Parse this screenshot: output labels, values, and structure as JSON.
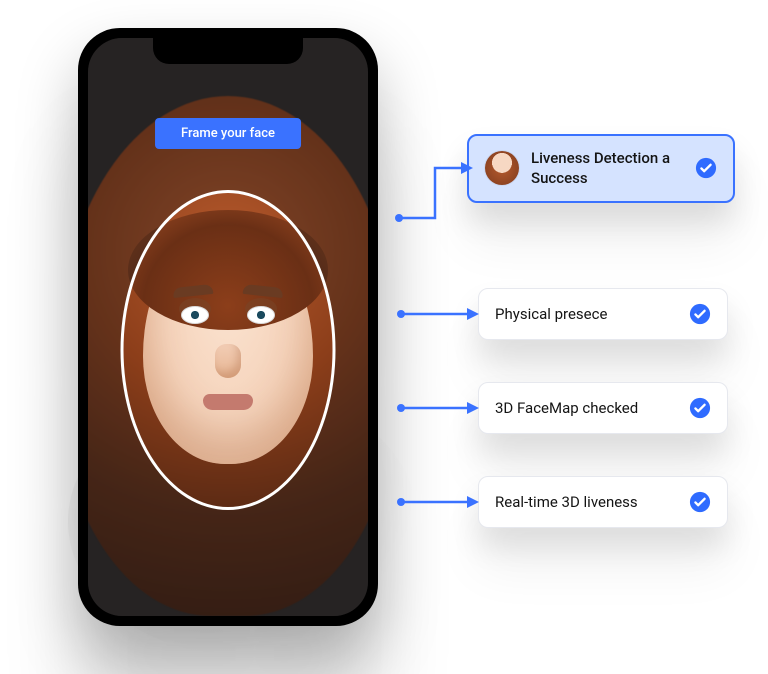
{
  "phone": {
    "frame_label": "Frame your face"
  },
  "main_card": {
    "title": "Liveness Detection a Success"
  },
  "sub_cards": [
    {
      "title": "Physical presece"
    },
    {
      "title": "3D FaceMap checked"
    },
    {
      "title": "Real-time 3D liveness"
    }
  ],
  "colors": {
    "accent": "#3a72ff"
  }
}
